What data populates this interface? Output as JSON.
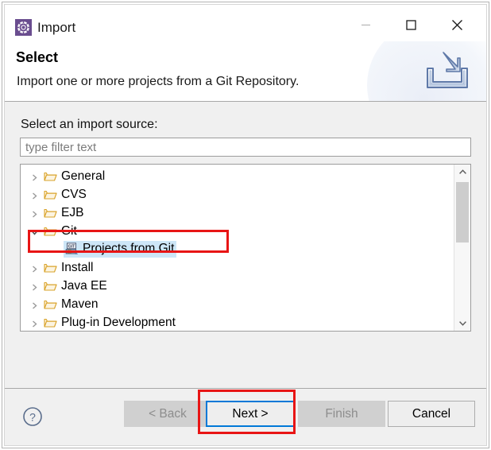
{
  "window": {
    "title": "Import",
    "icon": "eclipse-import-icon",
    "controls": {
      "minimize": "minimize-icon",
      "maximize": "maximize-icon",
      "close": "close-icon"
    }
  },
  "header": {
    "title": "Select",
    "description": "Import one or more projects from a Git Repository.",
    "icon": "import-tray-arrow-icon"
  },
  "main": {
    "source_label": "Select an import source:",
    "filter": {
      "value": "",
      "placeholder": "type filter text"
    },
    "tree": [
      {
        "label": "General",
        "icon": "folder-icon",
        "expanded": false,
        "indent": 0,
        "selected": false
      },
      {
        "label": "CVS",
        "icon": "folder-icon",
        "expanded": false,
        "indent": 0,
        "selected": false
      },
      {
        "label": "EJB",
        "icon": "folder-icon",
        "expanded": false,
        "indent": 0,
        "selected": false
      },
      {
        "label": "Git",
        "icon": "folder-icon",
        "expanded": true,
        "indent": 0,
        "selected": false
      },
      {
        "label": "Projects from Git",
        "icon": "git-project-icon",
        "expanded": null,
        "indent": 1,
        "selected": true
      },
      {
        "label": "Install",
        "icon": "folder-icon",
        "expanded": false,
        "indent": 0,
        "selected": false
      },
      {
        "label": "Java EE",
        "icon": "folder-icon",
        "expanded": false,
        "indent": 0,
        "selected": false
      },
      {
        "label": "Maven",
        "icon": "folder-icon",
        "expanded": false,
        "indent": 0,
        "selected": false
      },
      {
        "label": "Plug-in Development",
        "icon": "folder-icon",
        "expanded": false,
        "indent": 0,
        "selected": false
      }
    ],
    "scrollbar": {
      "up_arrow": "chevron-up-icon",
      "down_arrow": "chevron-down-icon"
    }
  },
  "footer": {
    "help": "help-icon",
    "buttons": {
      "back": {
        "label": "< Back",
        "state": "disabled"
      },
      "next": {
        "label": "Next >",
        "state": "focused"
      },
      "finish": {
        "label": "Finish",
        "state": "disabled"
      },
      "cancel": {
        "label": "Cancel",
        "state": "normal"
      }
    }
  },
  "colors": {
    "selection": "#cde6f7",
    "focus_border": "#0078d7",
    "annotation": "#e81515",
    "body_background": "#f0f0f0",
    "folder_icon": "#e3a62f",
    "title_icon": "#6a4d8f"
  },
  "annotations": [
    {
      "name": "tree-item-highlight",
      "target": "Projects from Git"
    },
    {
      "name": "next-button-highlight",
      "target": "Next >"
    }
  ]
}
